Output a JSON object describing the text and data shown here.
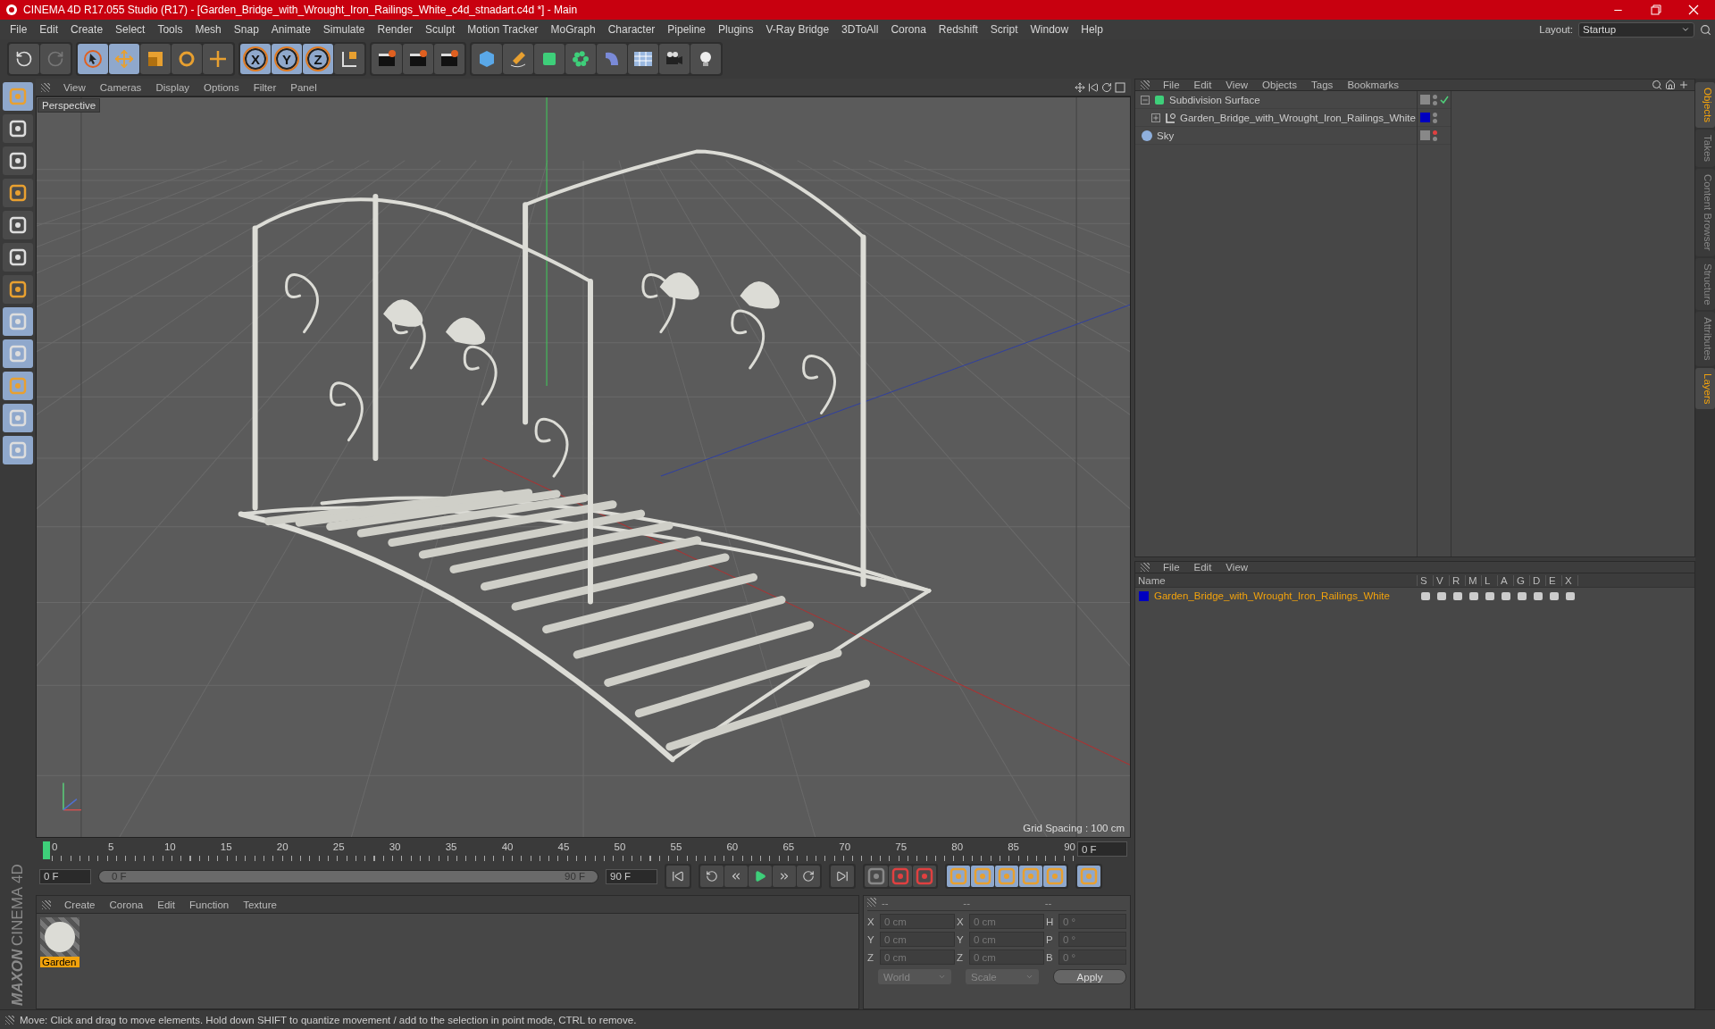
{
  "window": {
    "title": "CINEMA 4D R17.055 Studio (R17) - [Garden_Bridge_with_Wrought_Iron_Railings_White_c4d_stnadart.c4d *] - Main"
  },
  "menu": [
    "File",
    "Edit",
    "Create",
    "Select",
    "Tools",
    "Mesh",
    "Snap",
    "Animate",
    "Simulate",
    "Render",
    "Sculpt",
    "Motion Tracker",
    "MoGraph",
    "Character",
    "Pipeline",
    "Plugins",
    "V-Ray Bridge",
    "3DToAll",
    "Corona",
    "Redshift",
    "Script",
    "Window",
    "Help"
  ],
  "layout": {
    "label": "Layout:",
    "value": "Startup"
  },
  "toolbar": {
    "axis_buttons": [
      "X",
      "Y",
      "Z"
    ]
  },
  "branding": {
    "company": "MAXON",
    "product": "CINEMA 4D"
  },
  "viewport": {
    "menu": [
      "View",
      "Cameras",
      "Display",
      "Options",
      "Filter",
      "Panel"
    ],
    "camera": "Perspective",
    "grid_spacing": "Grid Spacing : 100 cm"
  },
  "objects_panel": {
    "menu": [
      "File",
      "Edit",
      "View",
      "Objects",
      "Tags",
      "Bookmarks"
    ],
    "items": [
      {
        "name": "Subdivision Surface",
        "kind": "subdivision",
        "expanded": true,
        "enabled": true,
        "children": [
          {
            "name": "Garden_Bridge_with_Wrought_Iron_Railings_White",
            "kind": "null",
            "expanded": false,
            "color": "#0000c0"
          }
        ]
      },
      {
        "name": "Sky",
        "kind": "sky",
        "editor_hidden": true
      }
    ]
  },
  "layers_panel": {
    "menu": [
      "File",
      "Edit",
      "View"
    ],
    "columns": [
      "Name",
      "S",
      "V",
      "R",
      "M",
      "L",
      "A",
      "G",
      "D",
      "E",
      "X"
    ],
    "rows": [
      {
        "name": "Garden_Bridge_with_Wrought_Iron_Railings_White",
        "color": "#0000c0"
      }
    ]
  },
  "side_tabs": [
    {
      "label": "Objects",
      "selected": true
    },
    {
      "label": "Takes",
      "selected": false
    },
    {
      "label": "Content Browser",
      "selected": false
    },
    {
      "label": "Structure",
      "selected": false
    },
    {
      "label": "Attributes",
      "selected": false
    },
    {
      "label": "Layers",
      "selected": true
    }
  ],
  "timeline": {
    "ticks": [
      "0",
      "5",
      "10",
      "15",
      "20",
      "25",
      "30",
      "35",
      "40",
      "45",
      "50",
      "55",
      "60",
      "65",
      "70",
      "75",
      "80",
      "85",
      "90"
    ],
    "end_frame": "0 F",
    "start_field": "0 F",
    "range": {
      "start": "0 F",
      "end": "90 F",
      "level": 1
    },
    "end_field": "90 F"
  },
  "materials": {
    "menu": [
      "Create",
      "Corona",
      "Edit",
      "Function",
      "Texture"
    ],
    "items": [
      {
        "name": "Garden",
        "selected": true
      }
    ]
  },
  "coordinates": {
    "headers": [
      "--",
      "--",
      "--"
    ],
    "rows": [
      {
        "l1": "X",
        "v1": "0 cm",
        "l2": "X",
        "v2": "0 cm",
        "l3": "H",
        "v3": "0 °"
      },
      {
        "l1": "Y",
        "v1": "0 cm",
        "l2": "Y",
        "v2": "0 cm",
        "l3": "P",
        "v3": "0 °"
      },
      {
        "l1": "Z",
        "v1": "0 cm",
        "l2": "Z",
        "v2": "0 cm",
        "l3": "B",
        "v3": "0 °"
      }
    ],
    "space": "World",
    "mode": "Scale",
    "apply": "Apply"
  },
  "status_bar": "Move: Click and drag to move elements. Hold down SHIFT to quantize movement / add to the selection in point mode, CTRL to remove."
}
